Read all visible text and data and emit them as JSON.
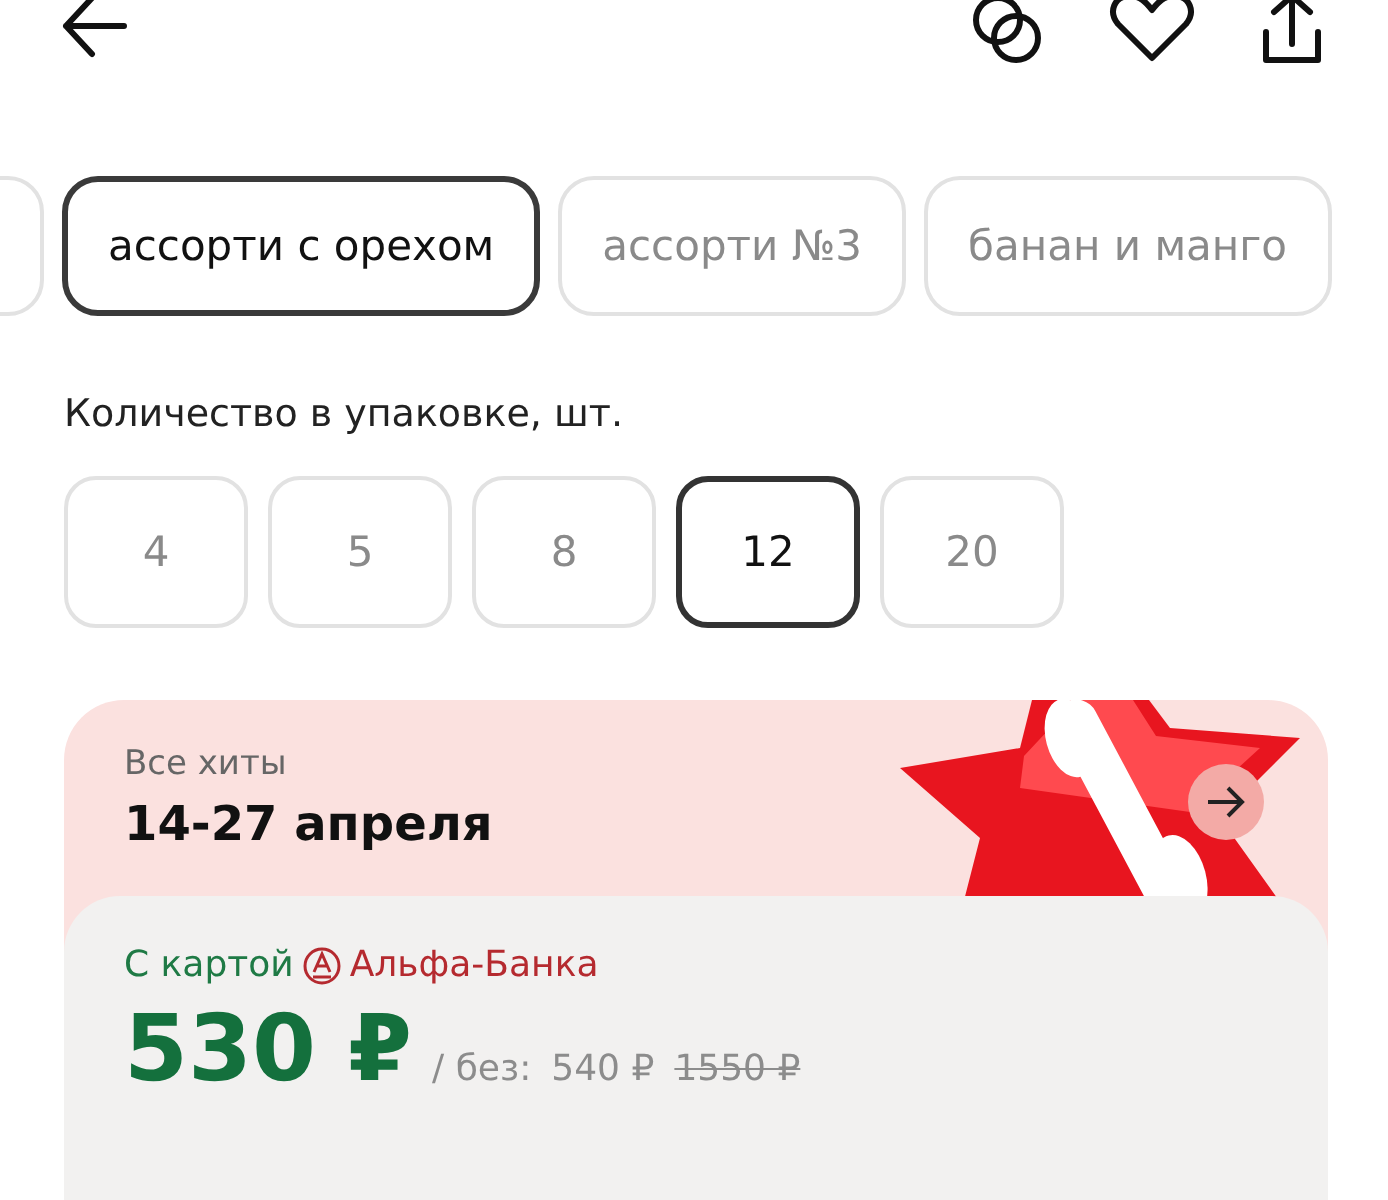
{
  "variants": [
    {
      "label": "ассорти с орехом",
      "selected": true
    },
    {
      "label": "ассорти №3",
      "selected": false
    },
    {
      "label": "банан и манго",
      "selected": false
    }
  ],
  "quantity": {
    "label": "Количество в упаковке, шт.",
    "options": [
      {
        "label": "4",
        "selected": false
      },
      {
        "label": "5",
        "selected": false
      },
      {
        "label": "8",
        "selected": false
      },
      {
        "label": "12",
        "selected": true
      },
      {
        "label": "20",
        "selected": false
      }
    ]
  },
  "promo": {
    "subtitle": "Все хиты",
    "title": "14-27 апреля"
  },
  "price": {
    "card_prefix": "С картой",
    "bank": "Альфа-Банка",
    "current": "530 ₽",
    "without_label": "/ без:",
    "without_price": "540 ₽",
    "old_price": "1550 ₽"
  }
}
